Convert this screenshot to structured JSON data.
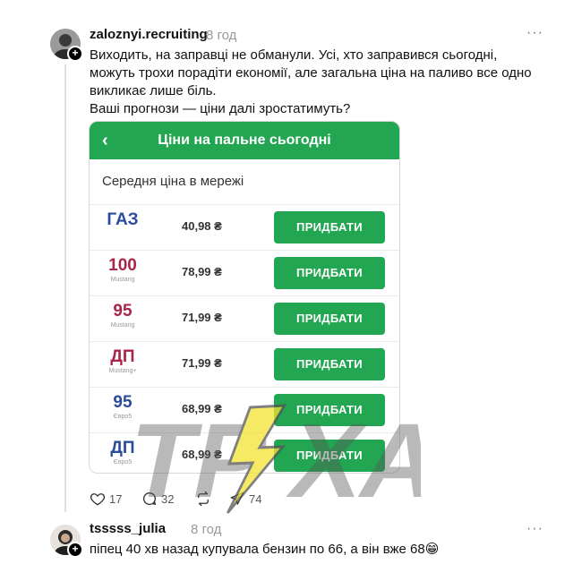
{
  "post": {
    "username": "zaloznyi.recruiting",
    "time": "8 год",
    "text_line1": "Виходить, на заправці не обманули. Усі, хто заправився сьогодні, можуть трохи порадіти економії, але загальна ціна на паливо все одно викликає лише біль.",
    "text_line2": "Ваші прогнози — ціни далі зростатимуть?",
    "more": "···"
  },
  "card": {
    "title": "Ціни на пальне сьогодні",
    "back": "‹",
    "subtitle": "Середня ціна в мережі",
    "buy_label": "ПРИДБАТИ",
    "rows": [
      {
        "code": "ГАЗ",
        "sub": "",
        "price": "40,98 ₴",
        "color": "#2b4c9b"
      },
      {
        "code": "100",
        "sub": "Mustang",
        "price": "78,99 ₴",
        "color": "#a8264a"
      },
      {
        "code": "95",
        "sub": "Mustang",
        "price": "71,99 ₴",
        "color": "#a8264a"
      },
      {
        "code": "ДП",
        "sub": "Mustang+",
        "price": "71,99 ₴",
        "color": "#a8264a"
      },
      {
        "code": "95",
        "sub": "Євро5",
        "price": "68,99 ₴",
        "color": "#2b4c9b"
      },
      {
        "code": "ДП",
        "sub": "Євро5",
        "price": "68,99 ₴",
        "color": "#2b4c9b"
      }
    ]
  },
  "actions": {
    "likes": "17",
    "comments": "32",
    "shares": "74"
  },
  "reply": {
    "username": "tsssss_julia",
    "time": "8 год",
    "text": "піпец 40 хв назад купувала бензин по 66, а він вже 68😁",
    "more": "···"
  },
  "watermark": {
    "text_left": "ТР",
    "text_right": "ХА"
  },
  "colors": {
    "accent_green": "#22a652",
    "thread_line": "#e0e0e0"
  }
}
